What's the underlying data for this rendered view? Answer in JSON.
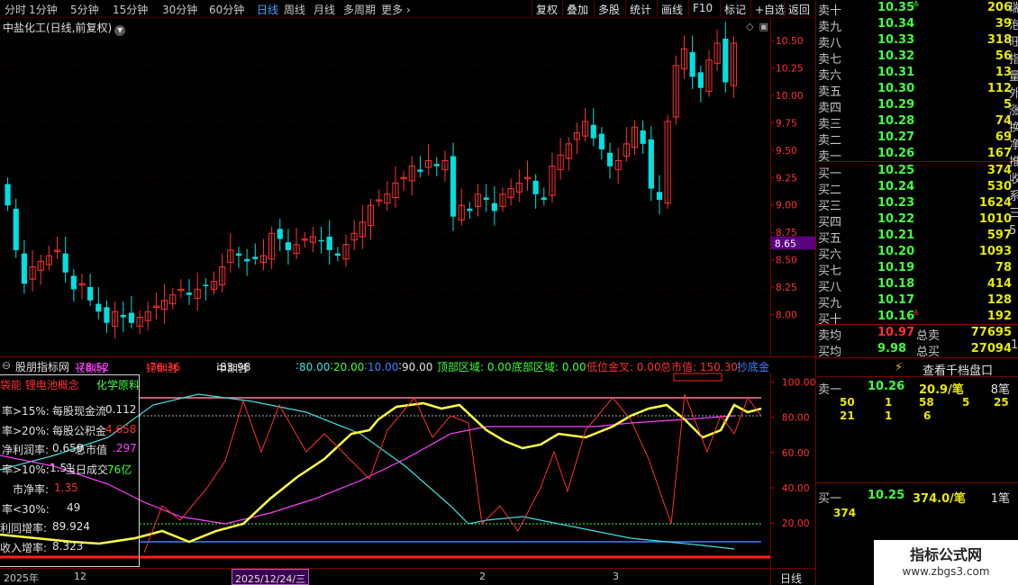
{
  "toolbar": {
    "periods": [
      "分时",
      "1分钟",
      "5分钟",
      "15分钟",
      "30分钟",
      "60分钟",
      "日线",
      "周线",
      "月线",
      "多周期",
      "更多"
    ],
    "active_period": "日线",
    "buttons": [
      "复权",
      "叠加",
      "多股",
      "统计",
      "画线",
      "F10",
      "标记",
      "+自选",
      "返回"
    ]
  },
  "main_chart": {
    "title": "中盐化工(日线,前复权)",
    "current_price_tag": "8.65",
    "price_axis": [
      "10.50",
      "10.25",
      "10.00",
      "9.75",
      "9.50",
      "9.25",
      "9.00",
      "8.75",
      "8.50",
      "8.25",
      "8.00"
    ]
  },
  "indicator": {
    "name": "股朋指标网",
    "long_label": "长期线",
    "long_value": "78.52",
    "short_label": "短期线",
    "short_value": "76.36",
    "mid_label": "中期线",
    "mid_value": "83.98",
    "levels": [
      "80.00",
      "20.00",
      "10.00",
      "90.00"
    ],
    "top_zone": "顶部区域: 0.00",
    "bottom_zone": "底部区域: 0.00",
    "golden_cross": "低位金叉: 0.00",
    "market_cap": "总市值: 150.30",
    "tail": "抄底金",
    "axis": [
      "100.00",
      "80.00",
      "60.00",
      "40.00",
      "20.00"
    ]
  },
  "info_panel": {
    "concept": "袋能 锂电池概念",
    "industry": "化学原料",
    "r1": "率>15%:",
    "r1_item": "每股现金流",
    "r1_val": "0.112",
    "r2": "率>20%:",
    "r2_item": "每股公积金",
    "r2_val": "4.658",
    "r3": "净利润率:",
    "r3_item": "总市值",
    "r3_val": "0.659",
    "r3_val2": ".297",
    "r4": "率>10%:",
    "r4_item": "当日成交",
    "r4_val": "1.51",
    "r4_val2": "76亿",
    "r5": "市净率:",
    "r5_val": "1.35",
    "r6": "率<30%:",
    "r6_val": "49",
    "r7": "利同增率:",
    "r7_val": "89.924",
    "r8": "收入增率:",
    "r8_val": "8.323"
  },
  "date_axis": {
    "labels": [
      "2025年",
      "12",
      "2",
      "3"
    ],
    "selected": "2025/12/24/三",
    "period": "日线"
  },
  "order_book": {
    "asks": [
      {
        "label": "卖十",
        "price": "10.35",
        "vol": "206",
        "mark": "≛"
      },
      {
        "label": "卖九",
        "price": "10.34",
        "vol": "39"
      },
      {
        "label": "卖八",
        "price": "10.33",
        "vol": "318"
      },
      {
        "label": "卖七",
        "price": "10.32",
        "vol": "56"
      },
      {
        "label": "卖六",
        "price": "10.31",
        "vol": "13"
      },
      {
        "label": "卖五",
        "price": "10.30",
        "vol": "112"
      },
      {
        "label": "卖四",
        "price": "10.29",
        "vol": "5"
      },
      {
        "label": "卖三",
        "price": "10.28",
        "vol": "74"
      },
      {
        "label": "卖二",
        "price": "10.27",
        "vol": "69"
      },
      {
        "label": "卖一",
        "price": "10.26",
        "vol": "167"
      }
    ],
    "bids": [
      {
        "label": "买一",
        "price": "10.25",
        "vol": "374"
      },
      {
        "label": "买二",
        "price": "10.24",
        "vol": "530"
      },
      {
        "label": "买三",
        "price": "10.23",
        "vol": "1624"
      },
      {
        "label": "买四",
        "price": "10.22",
        "vol": "1010"
      },
      {
        "label": "买五",
        "price": "10.21",
        "vol": "597"
      },
      {
        "label": "买六",
        "price": "10.20",
        "vol": "1093"
      },
      {
        "label": "买七",
        "price": "10.19",
        "vol": "78"
      },
      {
        "label": "买八",
        "price": "10.18",
        "vol": "414"
      },
      {
        "label": "买九",
        "price": "10.17",
        "vol": "128"
      },
      {
        "label": "买十",
        "price": "10.16",
        "vol": "192",
        "mark": "≛"
      }
    ],
    "avg_sell_label": "卖均",
    "avg_sell": "10.97",
    "total_sell_label": "总卖",
    "total_sell": "77695",
    "avg_buy_label": "买均",
    "avg_buy": "9.98",
    "total_buy_label": "总买",
    "total_buy": "27094",
    "view_thousand": "查看千档盘口",
    "detail_sell_label": "卖一",
    "detail_sell_price": "10.26",
    "detail_sell_amount": "20.9/笔",
    "detail_sell_count": "8笔",
    "detail_sell_orders": [
      "50",
      "1",
      "58",
      "5",
      "25",
      "21",
      "1",
      "6"
    ],
    "detail_buy_label": "买一",
    "detail_buy_price": "10.25",
    "detail_buy_amount": "374.0/笔",
    "detail_buy_count": "1笔",
    "detail_buy_orders": [
      "374"
    ],
    "side_chars": [
      "瑞",
      "泡",
      "旺",
      "指",
      "量",
      "外",
      "涨",
      "换",
      "净",
      "推",
      "收",
      "系",
      "三",
      "5"
    ],
    "side_tail": "1"
  },
  "watermark": {
    "title": "指标公式网",
    "url": "www.zbgs3.com"
  },
  "colors": {
    "up": "#ff3030",
    "down": "#00e0e0",
    "yellow": "#ffff40",
    "magenta": "#ff40ff",
    "cyan": "#40e0e0"
  }
}
